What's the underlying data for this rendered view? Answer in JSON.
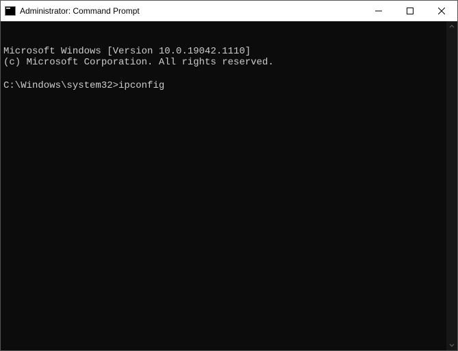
{
  "window": {
    "title": "Administrator: Command Prompt"
  },
  "terminal": {
    "line1": "Microsoft Windows [Version 10.0.19042.1110]",
    "line2": "(c) Microsoft Corporation. All rights reserved.",
    "blank": "",
    "prompt": "C:\\Windows\\system32>",
    "command": "ipconfig"
  }
}
